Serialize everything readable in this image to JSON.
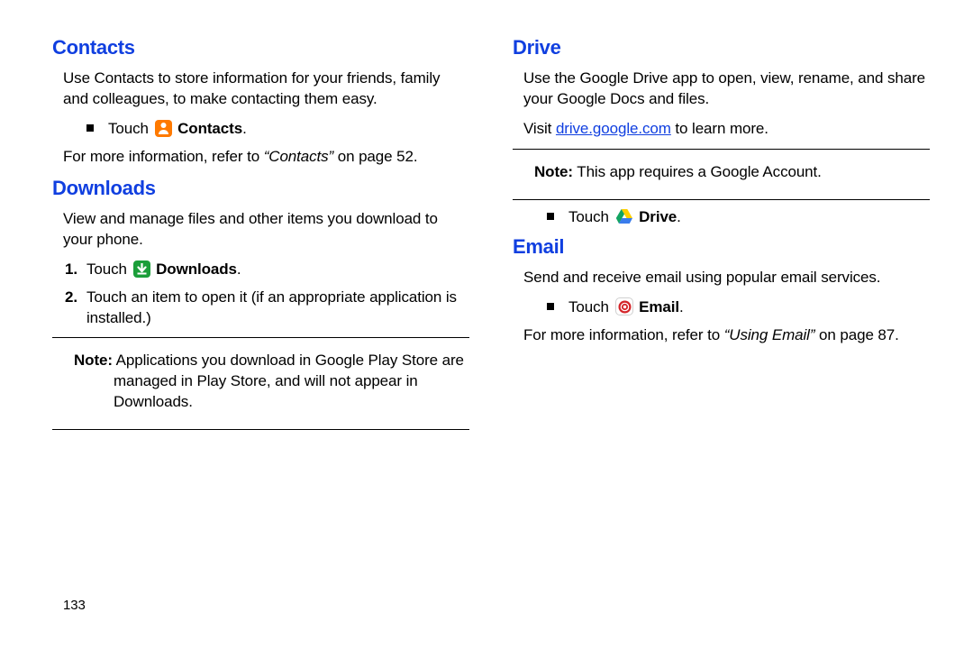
{
  "page_number": "133",
  "left": {
    "contacts": {
      "heading": "Contacts",
      "intro": "Use Contacts to store information for your friends, family and colleagues, to make contacting them easy.",
      "touch_pre": "Touch",
      "touch_label": "Contacts",
      "touch_post": ".",
      "ref_pre": "For more information, refer to ",
      "ref_italic": "“Contacts”",
      "ref_post": " on page 52."
    },
    "downloads": {
      "heading": "Downloads",
      "intro": "View and manage files and other items you download to your phone.",
      "s1_num": "1.",
      "s1_pre": "Touch",
      "s1_label": "Downloads",
      "s1_post": ".",
      "s2_num": "2.",
      "s2_text": "Touch an item to open it (if an appropriate application is installed.)",
      "note_label": "Note:",
      "note_body": "Applications you download in Google Play Store are managed in Play Store, and will not appear in Downloads."
    }
  },
  "right": {
    "drive": {
      "heading": "Drive",
      "intro": "Use the Google Drive app to open, view, rename, and share your Google Docs and files.",
      "visit_pre": "Visit ",
      "visit_link": "drive.google.com",
      "visit_post": " to learn more.",
      "note_label": "Note:",
      "note_body": "This app requires a Google Account.",
      "touch_pre": "Touch",
      "touch_label": "Drive",
      "touch_post": "."
    },
    "email": {
      "heading": "Email",
      "intro": "Send and receive email using popular email services.",
      "touch_pre": "Touch",
      "touch_label": "Email",
      "touch_post": ".",
      "ref_pre": "For more information, refer to ",
      "ref_italic": "“Using Email”",
      "ref_post": " on page 87."
    }
  }
}
